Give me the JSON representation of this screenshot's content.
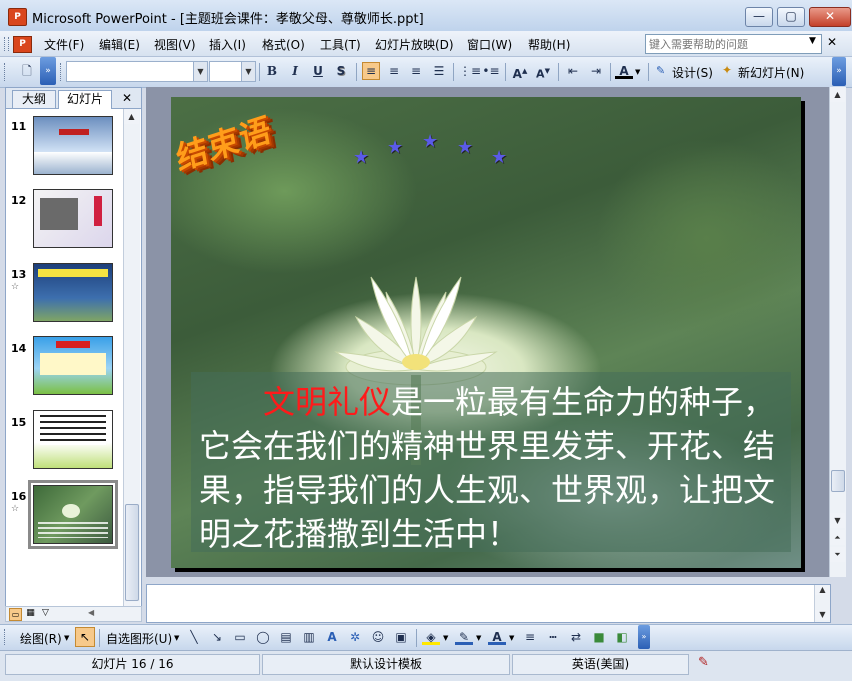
{
  "window": {
    "app_icon_text": "P",
    "title": "Microsoft PowerPoint - [主题班会课件：孝敬父母、尊敬师长.ppt]",
    "min": "—",
    "max": "▢",
    "close": "✕"
  },
  "menu": {
    "items": [
      "文件(F)",
      "编辑(E)",
      "视图(V)",
      "插入(I)",
      "格式(O)",
      "工具(T)",
      "幻灯片放映(D)",
      "窗口(W)",
      "帮助(H)"
    ],
    "help_placeholder": "键入需要帮助的问题",
    "doc_close": "✕"
  },
  "toolbar": {
    "font_name": "",
    "font_size": "",
    "bold": "B",
    "italic": "I",
    "underline": "U",
    "shadow": "S",
    "design_label": "设计(S)",
    "new_slide_label": "新幻灯片(N)"
  },
  "left_pane": {
    "tab_outline": "大纲",
    "tab_slides": "幻灯片",
    "close": "✕",
    "thumbnails": [
      {
        "num": "11",
        "star": ""
      },
      {
        "num": "12",
        "star": ""
      },
      {
        "num": "13",
        "star": "☆"
      },
      {
        "num": "14",
        "star": ""
      },
      {
        "num": "15",
        "star": ""
      },
      {
        "num": "16",
        "star": "☆"
      }
    ]
  },
  "slide": {
    "title": "结束语",
    "stars": [
      "★",
      "★",
      "★",
      "★",
      "★"
    ],
    "body_highlight": "文明礼仪",
    "body_rest": "是一粒最有生命力的种子，它会在我们的精神世界里发芽、开花、结果，指导我们的人生观、世界观，让把文明之花播撒到生活中！"
  },
  "drawing_toolbar": {
    "draw_label": "绘图(R)",
    "autoshapes_label": "自选图形(U)"
  },
  "status": {
    "slide_count": "幻灯片 16 / 16",
    "template": "默认设计模板",
    "language": "英语(美国)"
  }
}
